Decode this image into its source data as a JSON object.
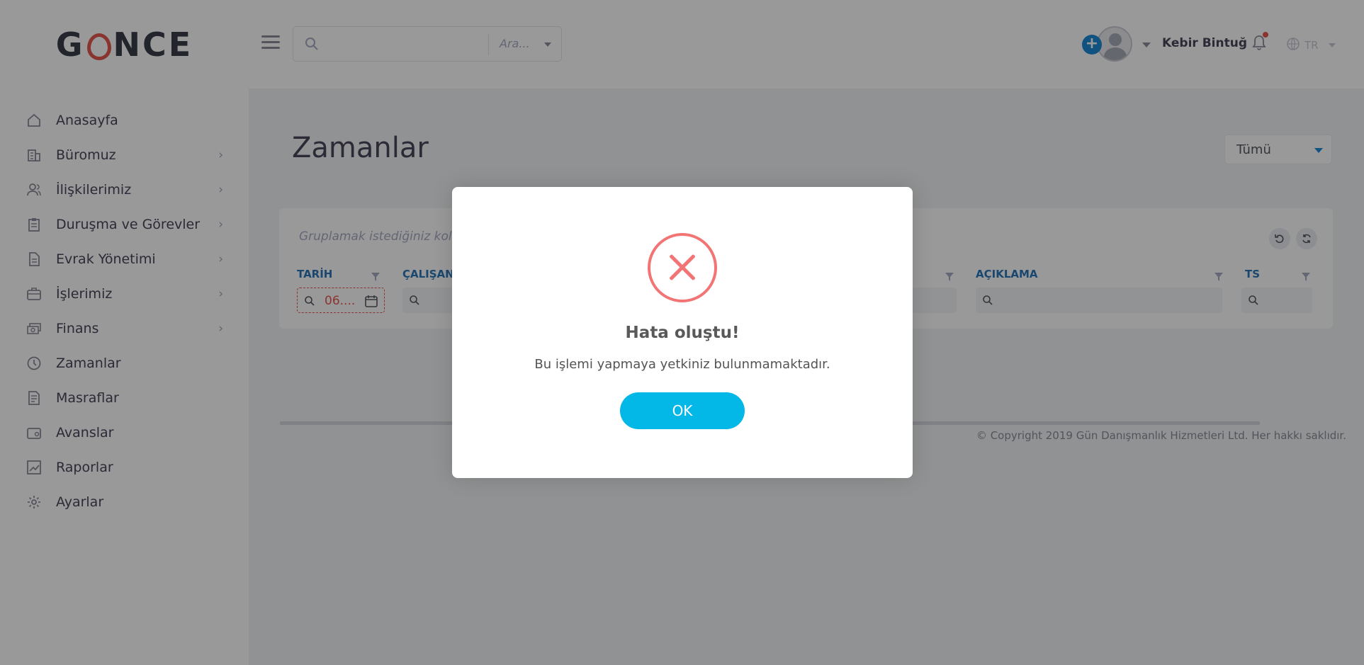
{
  "brand": {
    "left": "G",
    "right": "NCE"
  },
  "sidebar": {
    "items": [
      {
        "label": "Anasayfa",
        "icon": "home-icon",
        "has_children": false
      },
      {
        "label": "Büromuz",
        "icon": "building-icon",
        "has_children": true
      },
      {
        "label": "İlişkilerimiz",
        "icon": "users-icon",
        "has_children": true
      },
      {
        "label": "Duruşma ve Görevler",
        "icon": "clipboard-icon",
        "has_children": true
      },
      {
        "label": "Evrak Yönetimi",
        "icon": "document-icon",
        "has_children": true
      },
      {
        "label": "İşlerimiz",
        "icon": "briefcase-icon",
        "has_children": true
      },
      {
        "label": "Finans",
        "icon": "money-icon",
        "has_children": true
      },
      {
        "label": "Zamanlar",
        "icon": "clock-icon",
        "has_children": false
      },
      {
        "label": "Masraflar",
        "icon": "receipt-icon",
        "has_children": false
      },
      {
        "label": "Avanslar",
        "icon": "wallet-icon",
        "has_children": false
      },
      {
        "label": "Raporlar",
        "icon": "chart-icon",
        "has_children": false
      },
      {
        "label": "Ayarlar",
        "icon": "gear-icon",
        "has_children": false
      }
    ]
  },
  "topbar": {
    "search_placeholder": "",
    "search_scope": "Ara...",
    "user_name": "Kebir Bintuğ",
    "language": "TR"
  },
  "main": {
    "title": "Zamanlar",
    "filter_value": "Tümü",
    "group_hint": "Gruplamak istediğiniz kolon",
    "columns": [
      {
        "label": "TARİH",
        "filter_value": "06...."
      },
      {
        "label": "ÇALIŞAN",
        "filter_value": ""
      },
      {
        "label": "AÇIKLAMA",
        "filter_value": ""
      },
      {
        "label": "TS",
        "filter_value": ""
      }
    ],
    "copyright": "© Copyright 2019 Gün Danışmanlık Hizmetleri Ltd. Her hakkı saklıdır."
  },
  "modal": {
    "icon": "error-x-icon",
    "title": "Hata oluştu!",
    "message": "Bu işlemi yapmaya yetkiniz bulunmamaktadır.",
    "ok_label": "OK"
  },
  "colors": {
    "accent": "#03b7e7",
    "error": "#f27474",
    "brand_red": "#e6574f",
    "link_blue": "#2c77b9"
  }
}
